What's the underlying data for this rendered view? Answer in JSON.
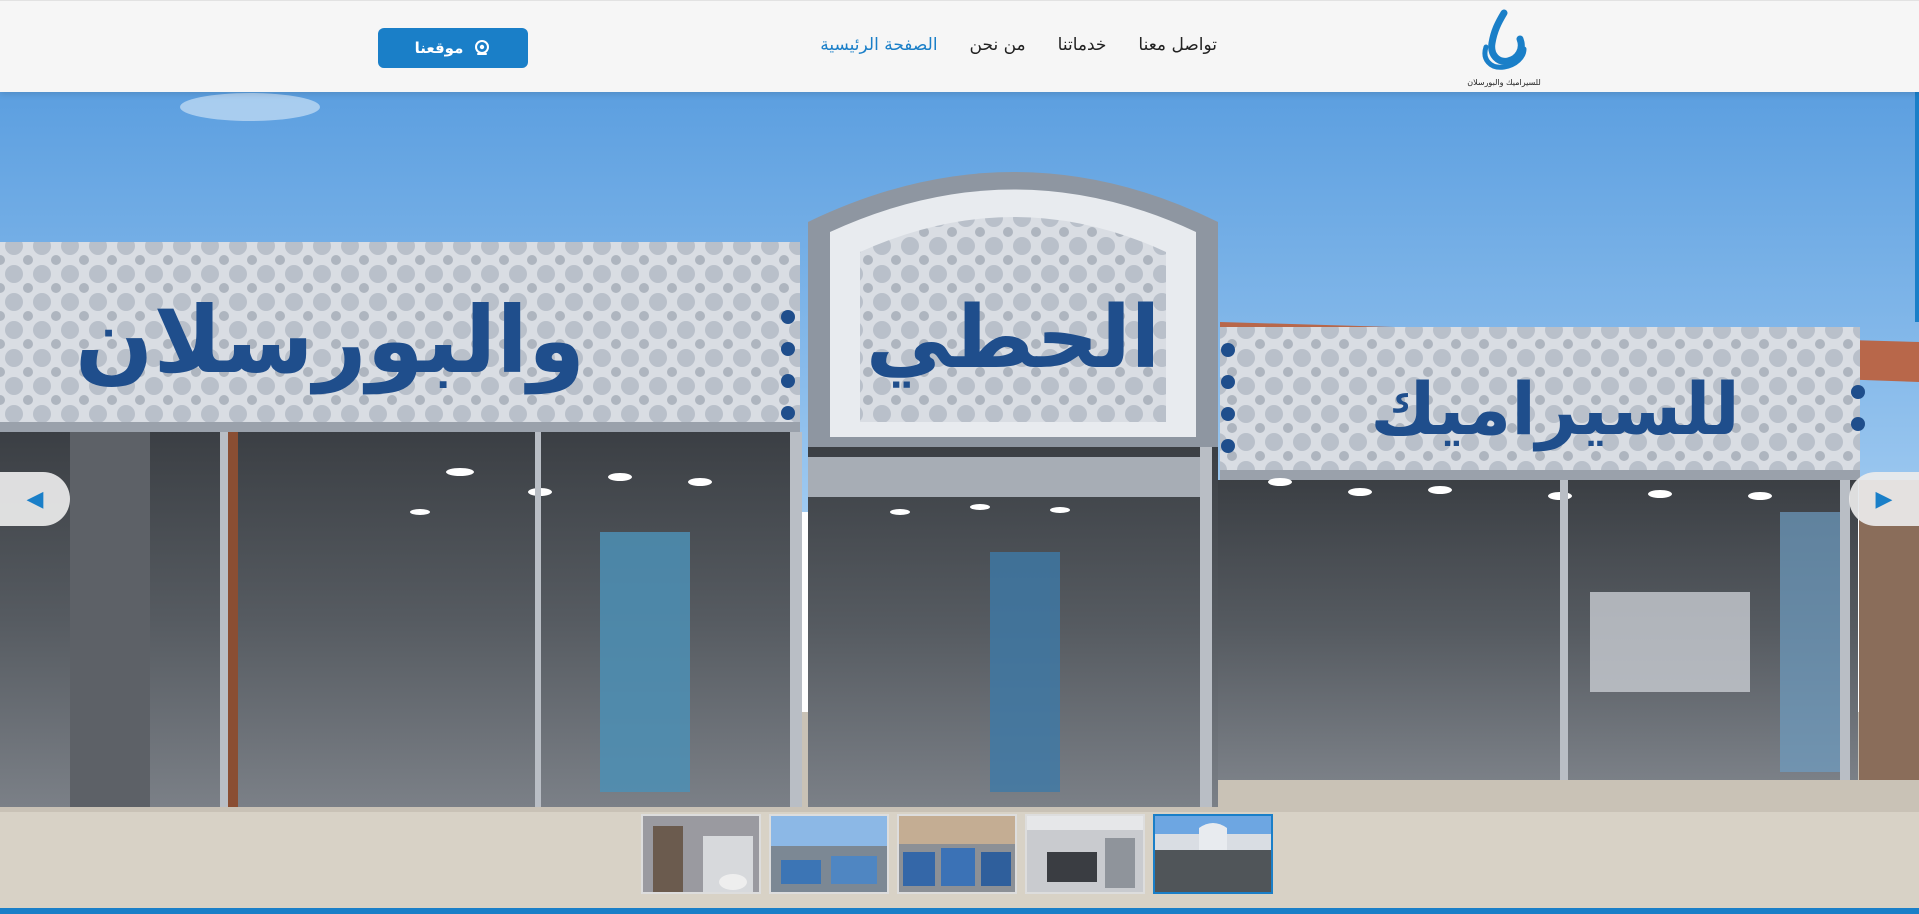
{
  "header": {
    "logo": {
      "icon": "brand-logo-calligraphy",
      "caption": "للسيراميك والبورسلان"
    },
    "nav": [
      {
        "label": "الصفحة الرئيسية",
        "active": true
      },
      {
        "label": "من نحن",
        "active": false
      },
      {
        "label": "خدماتنا",
        "active": false
      },
      {
        "label": "تواصل معنا",
        "active": false
      }
    ],
    "location_button": {
      "label": "موقعنا",
      "icon": "location-pin-icon"
    }
  },
  "hero": {
    "signage": {
      "left": "والبورسلان",
      "center": "الحطي",
      "right": "للسيراميك"
    },
    "prev_icon": "◀",
    "next_icon": "▶",
    "thumbnail_count": 5,
    "active_thumbnail": 5
  },
  "colors": {
    "accent": "#1a7fc8",
    "header_bg": "#f6f6f6",
    "sign_blue": "#1f4e8c"
  }
}
